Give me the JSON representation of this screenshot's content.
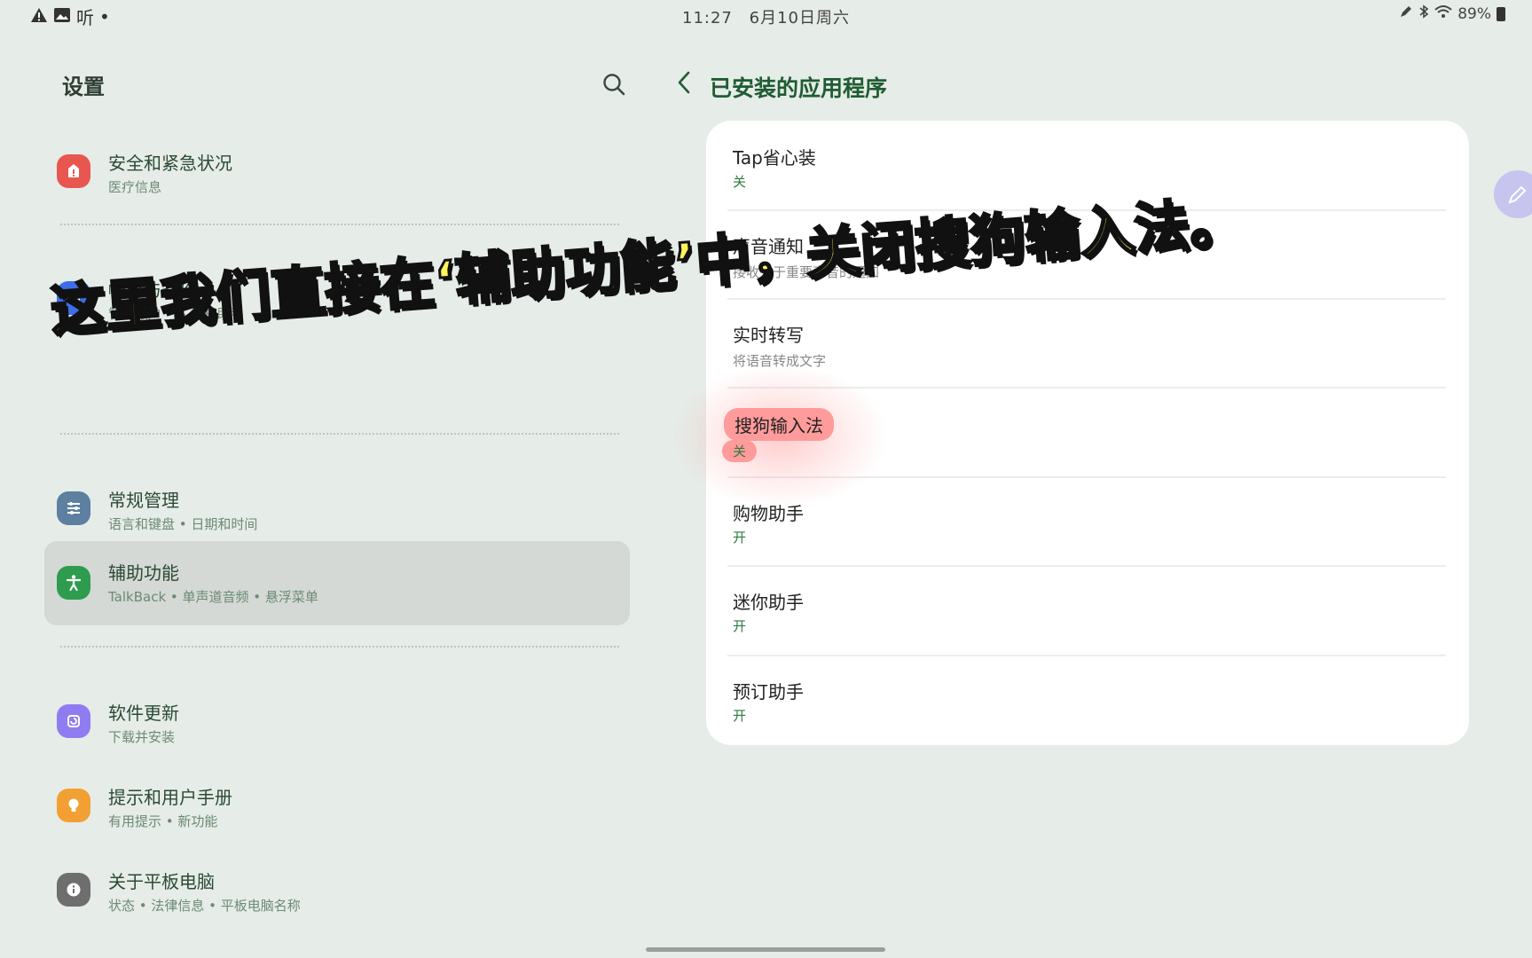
{
  "status_bar": {
    "left_icons": [
      "warning-icon",
      "gallery-icon",
      "listen-icon"
    ],
    "listen_label": "听",
    "dot": "•",
    "time": "11:27",
    "date": "6月10日周六",
    "battery": "89%",
    "right_icons": [
      "pen-icon",
      "bluetooth-icon",
      "wifi-icon",
      "battery-icon"
    ]
  },
  "settings": {
    "title": "设置",
    "items": [
      {
        "title": "安全和紧急状况",
        "sub": "医疗信息",
        "icon": "emergency-icon",
        "color": "#e8574f"
      },
      {
        "title": "帐户与备份",
        "sub": "管理帐户 • S 换机助手",
        "icon": "sync-icon",
        "color": "#3d6ee8"
      },
      {
        "title": "常规管理",
        "sub": "语言和键盘 • 日期和时间",
        "icon": "sliders-icon",
        "color": "#5d7fa0"
      },
      {
        "title": "辅助功能",
        "sub": "TalkBack • 单声道音频 • 悬浮菜单",
        "icon": "accessibility-icon",
        "color": "#2e9c4f"
      },
      {
        "title": "软件更新",
        "sub": "下载并安装",
        "icon": "update-icon",
        "color": "#8f7cf0"
      },
      {
        "title": "提示和用户手册",
        "sub": "有用提示 • 新功能",
        "icon": "bulb-icon",
        "color": "#f2a034"
      },
      {
        "title": "关于平板电脑",
        "sub": "状态 • 法律信息 • 平板电脑名称",
        "icon": "info-icon",
        "color": "#6e6e6e"
      }
    ]
  },
  "installed_apps": {
    "title": "已安装的应用程序",
    "apps": [
      {
        "name": "Tap省心装",
        "status": "关"
      },
      {
        "name": "声音通知",
        "desc": "接收关于重要声音的通知"
      },
      {
        "name": "实时转写",
        "desc": "将语音转成文字"
      },
      {
        "name": "搜狗输入法",
        "status": "关"
      },
      {
        "name": "购物助手",
        "status": "开"
      },
      {
        "name": "迷你助手",
        "status": "开"
      },
      {
        "name": "预订助手",
        "status": "开"
      }
    ]
  },
  "caption": "这里我们直接在‘辅助功能’中，关闭搜狗输入法。",
  "colors": {
    "accent": "#2d7a3f",
    "highlight": "#ff9b9b",
    "caption_fill": "#fff45a"
  }
}
